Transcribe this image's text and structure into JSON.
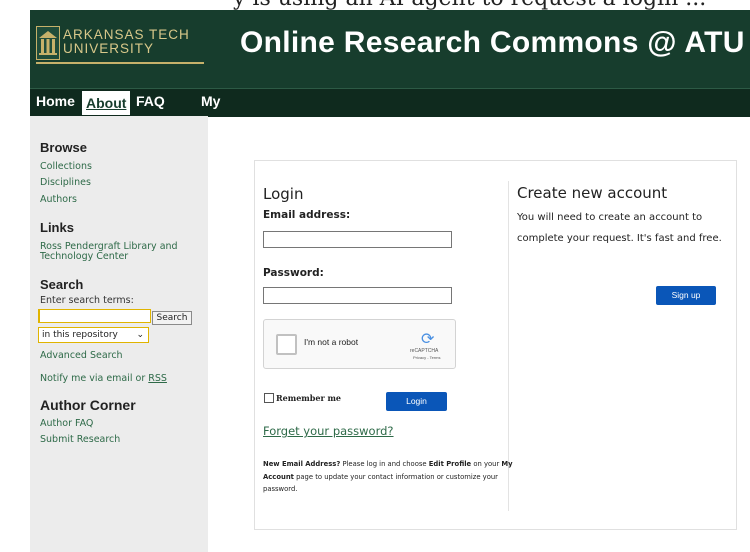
{
  "header": {
    "top_cut_text": "y is using an AI agent to request a login ...",
    "logo_line1": "ARKANSAS TECH",
    "logo_line2": "UNIVERSITY",
    "site_title": "Online Research Commons @ ATU"
  },
  "nav": {
    "items": [
      {
        "label": "Home"
      },
      {
        "label": "About"
      },
      {
        "label": "FAQ"
      },
      {
        "label": "My"
      }
    ],
    "active": "About"
  },
  "sidebar": {
    "browse": {
      "heading": "Browse",
      "links": [
        "Collections",
        "Disciplines",
        "Authors"
      ]
    },
    "links": {
      "heading": "Links",
      "link_line1": "Ross Pendergraft Library and",
      "link_line2": "Technology Center"
    },
    "search": {
      "heading": "Search",
      "prompt": "Enter search terms:",
      "button": "Search",
      "scope": "in this repository",
      "advanced": "Advanced Search",
      "notify_prefix": "Notify me via email or ",
      "notify_rss": "RSS"
    },
    "author_corner": {
      "heading": "Author Corner",
      "links": [
        "Author FAQ",
        "Submit Research"
      ]
    }
  },
  "login": {
    "title": "Login",
    "email_label": "Email address:",
    "email_value": "",
    "password_label": "Password:",
    "password_value": "",
    "captcha_label": "I'm not a robot",
    "captcha_brand": "reCAPTCHA",
    "captcha_terms": "Privacy - Terms",
    "remember_label": "Remember me",
    "login_button": "Login",
    "forgot_link": "Forget your password?",
    "note_bold_1": "New Email Address?",
    "note_text_1": " Please log in and choose ",
    "note_bold_2": "Edit Profile",
    "note_text_2": " on your ",
    "note_bold_3": "My Account",
    "note_text_3": " page to update your contact information or customize your password."
  },
  "create_account": {
    "title": "Create new account",
    "text": "You will need to create an account to complete your request. It's fast and free.",
    "signup_button": "Sign up"
  },
  "colors": {
    "header_bg": "#173d2d",
    "nav_bg": "#0f2a1e",
    "link": "#2e6a48",
    "button": "#0a56b8",
    "sidebar_bg": "#ececec"
  }
}
